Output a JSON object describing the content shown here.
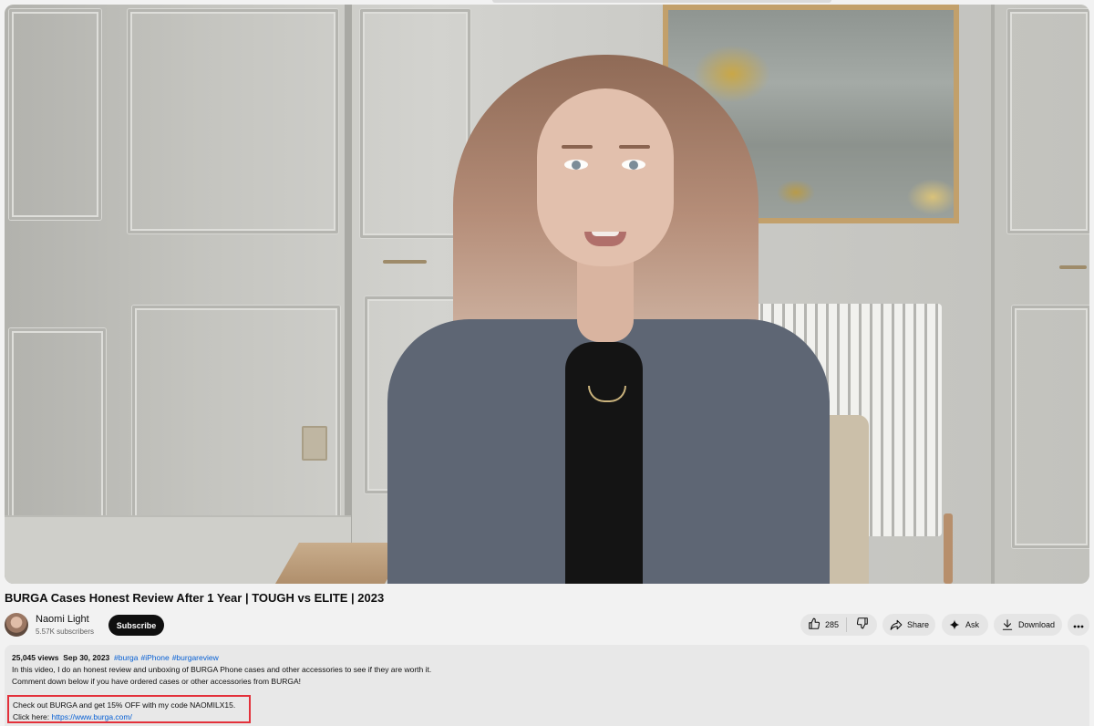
{
  "video": {
    "title": "BURGA Cases Honest Review After 1 Year | TOUGH vs ELITE | 2023"
  },
  "channel": {
    "name": "Naomi Light",
    "subscribers": "5.57K subscribers",
    "subscribe_label": "Subscribe"
  },
  "actions": {
    "like_count": "285",
    "share_label": "Share",
    "ask_label": "Ask",
    "download_label": "Download"
  },
  "description": {
    "views": "25,045 views",
    "date": "Sep 30, 2023",
    "hashtags": [
      "#burga",
      "#iPhone",
      "#burgareview"
    ],
    "line1": "In this video, I do an honest review and unboxing of BURGA Phone cases and other accessories to see if they are worth it.",
    "line2": "Comment down below if you have ordered cases or other accessories from BURGA!",
    "promo_line": "Check out BURGA and get 15% OFF with my code NAOMILX15.",
    "click_prefix": "Click here: ",
    "link": "https://www.burga.com/"
  },
  "colors": {
    "accent_link": "#065fd4",
    "highlight_box": "#e3313b",
    "subscribe_bg": "#0f0f0f"
  },
  "icons": [
    "thumbs-up-icon",
    "thumbs-down-icon",
    "share-icon",
    "sparkle-icon",
    "download-icon",
    "more-icon"
  ]
}
